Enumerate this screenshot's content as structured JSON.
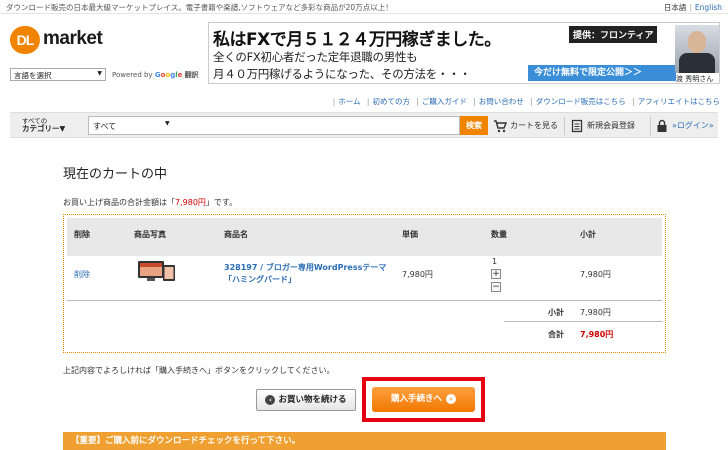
{
  "topbar": {
    "tagline": "ダウンロード販売の日本最大級マーケットプレイス。電子書籍や楽譜,ソフトウェアなど多彩な商品が20万点以上！",
    "lang_ja": "日本語",
    "lang_sep": "|",
    "lang_en": "English"
  },
  "logo": {
    "badge": "DL",
    "word": "market"
  },
  "translate": {
    "select_label": "言語を選択",
    "powered_by": "Powered by",
    "google": [
      "G",
      "o",
      "o",
      "g",
      "l",
      "e"
    ],
    "translate_word": "翻訳"
  },
  "banner": {
    "headline": "私はFXで月５１２４万円稼ぎました。",
    "sponsor": "提供：フロンティア",
    "line1": "全くのFX初心者だった定年退職の男性も",
    "line2": "月４０万円稼げるようになった、その方法を・・・",
    "cta": "今だけ無料で限定公開＞＞",
    "person": "渡 秀明さん"
  },
  "subnav": {
    "items": [
      "ホーム",
      "初めての方",
      "ご購入ガイド",
      "お問い合わせ",
      "ダウンロード販売はこちら",
      "アフィリエイトはこちら"
    ]
  },
  "searchbar": {
    "category_small": "すべての",
    "category_big": "カテゴリー▼",
    "search_value": "すべて",
    "search_button": "検索",
    "cart_label": "カートを見る",
    "register_label": "新規会員登録",
    "login_label": "»ログイン»"
  },
  "page": {
    "title": "現在のカートの中",
    "total_prefix": "お買い上げ商品の合計金額は「",
    "total_value": "7,980円",
    "total_suffix": "」です。",
    "instruction": "上記内容でよろしければ「購入手続きへ」ボタンをクリックしてください。",
    "continue_button": "お買い物を続ける",
    "purchase_button": "購入手続きへ",
    "notice": "【重要】ご購入前にダウンロードチェックを行って下さい。"
  },
  "cart": {
    "headers": [
      "削除",
      "商品写真",
      "商品名",
      "単価",
      "数量",
      "小計"
    ],
    "items": [
      {
        "delete_label": "削除",
        "name": "328197 / ブロガー専用WordPressテーマ「ハミングバード」",
        "unit_price": "7,980円",
        "quantity": "1",
        "qty_plus": "+",
        "qty_minus": "−",
        "subtotal": "7,980円"
      }
    ],
    "subtotal_label": "小計",
    "subtotal_value": "7,980円",
    "total_label": "合計",
    "total_value": "7,980円"
  },
  "colors": {
    "accent": "#f08300",
    "link": "#2a6db5",
    "price_red": "#d40000",
    "highlight": "#e60012"
  }
}
